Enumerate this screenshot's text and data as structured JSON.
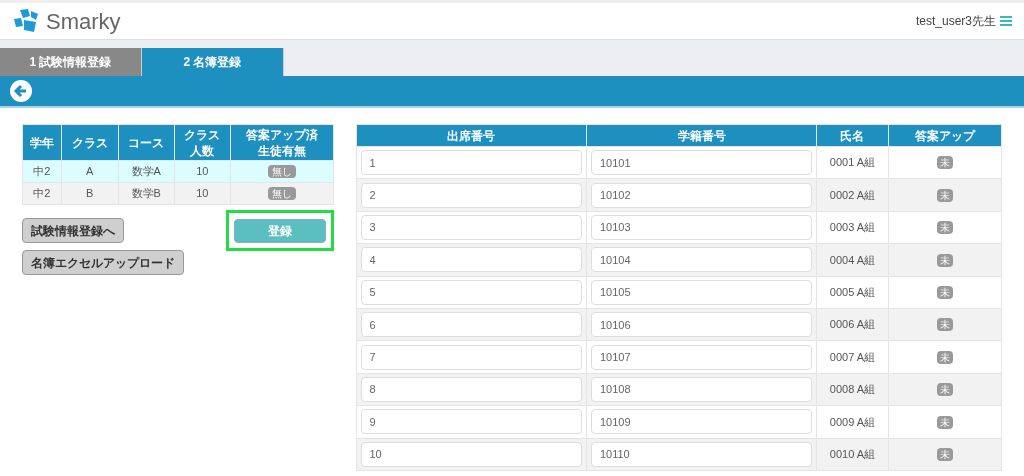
{
  "header": {
    "brand": "Smarky",
    "user": "test_user3先生"
  },
  "tabs": [
    {
      "label": "1 試験情報登録",
      "selected": false
    },
    {
      "label": "2 名簿登録",
      "selected": true
    }
  ],
  "class_table": {
    "columns": [
      "学年",
      "クラス",
      "コース",
      "クラス人数",
      "答案アップ済生徒有無"
    ],
    "rows": [
      {
        "cells": [
          "中2",
          "A",
          "数学A",
          "10"
        ],
        "badge": "無し",
        "selected": true
      },
      {
        "cells": [
          "中2",
          "B",
          "数学B",
          "10"
        ],
        "badge": "無し",
        "selected": false
      }
    ]
  },
  "buttons": [
    {
      "label": "試験情報登録へ",
      "kind": "secondary"
    },
    {
      "label": "名簿エクセルアップロード",
      "kind": "secondary"
    },
    {
      "label": "登録",
      "kind": "primary",
      "highlighted": true
    }
  ],
  "student_table": {
    "columns": [
      "出席番号",
      "学籍番号",
      "氏名",
      "答案アップ"
    ],
    "rows": [
      {
        "seat": "1",
        "student_id": "10101",
        "name": "0001 A組",
        "badge": "未"
      },
      {
        "seat": "2",
        "student_id": "10102",
        "name": "0002 A組",
        "badge": "未"
      },
      {
        "seat": "3",
        "student_id": "10103",
        "name": "0003 A組",
        "badge": "未"
      },
      {
        "seat": "4",
        "student_id": "10104",
        "name": "0004 A組",
        "badge": "未"
      },
      {
        "seat": "5",
        "student_id": "10105",
        "name": "0005 A組",
        "badge": "未"
      },
      {
        "seat": "6",
        "student_id": "10106",
        "name": "0006 A組",
        "badge": "未"
      },
      {
        "seat": "7",
        "student_id": "10107",
        "name": "0007 A組",
        "badge": "未"
      },
      {
        "seat": "8",
        "student_id": "10108",
        "name": "0008 A組",
        "badge": "未"
      },
      {
        "seat": "9",
        "student_id": "10109",
        "name": "0009 A組",
        "badge": "未"
      },
      {
        "seat": "10",
        "student_id": "10110",
        "name": "0010 A組",
        "badge": "未"
      }
    ]
  }
}
